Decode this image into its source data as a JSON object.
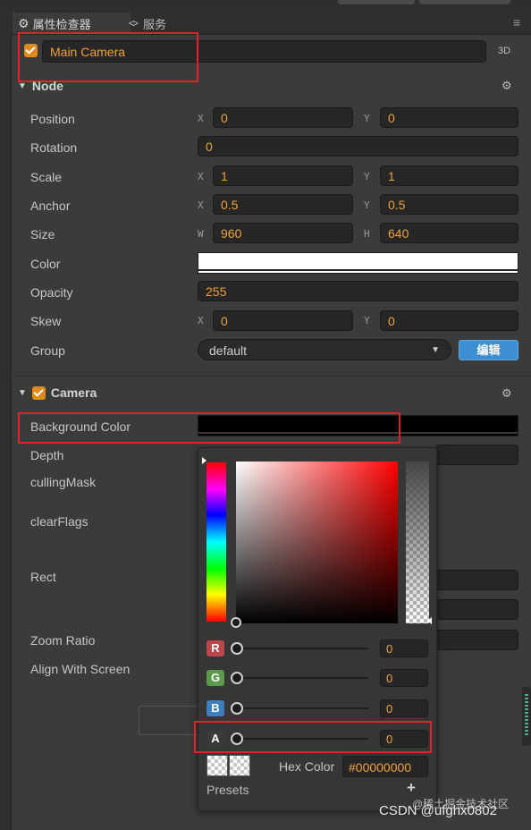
{
  "tabs": [
    {
      "label": "属性检查器",
      "icon": "gear-icon"
    },
    {
      "label": "服务",
      "icon": "double-chevron-icon"
    }
  ],
  "node_header": {
    "name_value": "Main Camera",
    "badge": "3D",
    "section_title": "Node"
  },
  "node": {
    "position": {
      "label": "Position",
      "x_axis": "X",
      "x": "0",
      "y_axis": "Y",
      "y": "0"
    },
    "rotation": {
      "label": "Rotation",
      "value": "0"
    },
    "scale": {
      "label": "Scale",
      "x_axis": "X",
      "x": "1",
      "y_axis": "Y",
      "y": "1"
    },
    "anchor": {
      "label": "Anchor",
      "x_axis": "X",
      "x": "0.5",
      "y_axis": "Y",
      "y": "0.5"
    },
    "size": {
      "label": "Size",
      "w_axis": "W",
      "w": "960",
      "h_axis": "H",
      "h": "640"
    },
    "color": {
      "label": "Color",
      "value_hex": "#ffffff"
    },
    "opacity": {
      "label": "Opacity",
      "value": "255"
    },
    "skew": {
      "label": "Skew",
      "x_axis": "X",
      "x": "0",
      "y_axis": "Y",
      "y": "0"
    },
    "group": {
      "label": "Group",
      "value": "default",
      "edit_label": "编辑"
    }
  },
  "camera": {
    "section_title": "Camera",
    "background_color": {
      "label": "Background Color",
      "value_hex": "#000000"
    },
    "depth": {
      "label": "Depth"
    },
    "culling_mask": {
      "label": "cullingMask"
    },
    "clear_flags": {
      "label": "clearFlags"
    },
    "rect": {
      "label": "Rect"
    },
    "zoom_ratio": {
      "label": "Zoom Ratio"
    },
    "align_with_screen": {
      "label": "Align With Screen"
    }
  },
  "color_picker": {
    "channels": [
      {
        "badge": "R",
        "value": "0",
        "color": "#c0454a"
      },
      {
        "badge": "G",
        "value": "0",
        "color": "#5a9a4a"
      },
      {
        "badge": "B",
        "value": "0",
        "color": "#3c7fc0"
      },
      {
        "badge": "A",
        "value": "0",
        "color": "#3a3a3a"
      }
    ],
    "hex_label": "Hex Color",
    "hex_value": "#00000000",
    "presets_label": "Presets",
    "add_symbol": "+"
  },
  "watermark": {
    "primary": "CSDN @ufghx0802",
    "secondary": "@稀土掘金技术社区"
  },
  "colors": {
    "accent_orange": "#e08a1e",
    "highlight_red": "#e0232b",
    "edit_button_blue": "#3d8fd1"
  }
}
